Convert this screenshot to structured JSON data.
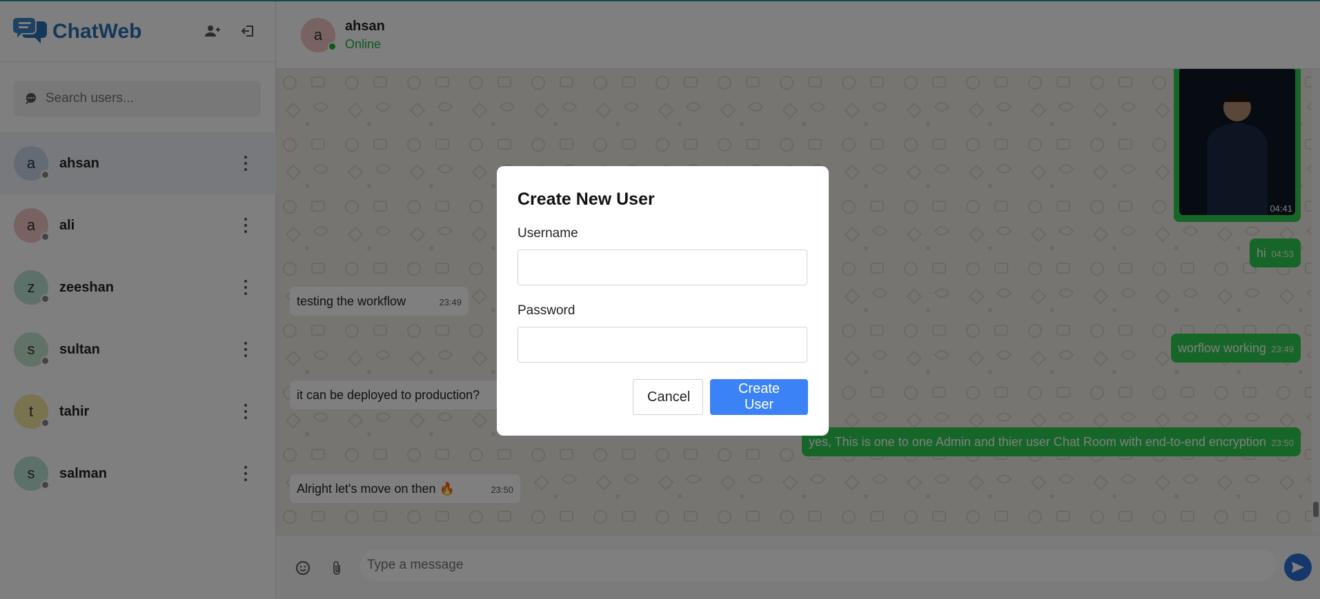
{
  "app": {
    "brand": "ChatWeb"
  },
  "sidebar": {
    "add_user_icon": "user-plus-icon",
    "logout_icon": "logout-icon",
    "search_placeholder": "Search users...",
    "users": [
      {
        "initial": "a",
        "name": "ahsan",
        "color": "#c7d6ea"
      },
      {
        "initial": "a",
        "name": "ali",
        "color": "#f1c4c4"
      },
      {
        "initial": "z",
        "name": "zeeshan",
        "color": "#b8e2d4"
      },
      {
        "initial": "s",
        "name": "sultan",
        "color": "#c4e5cc"
      },
      {
        "initial": "t",
        "name": "tahir",
        "color": "#f2e7a0"
      },
      {
        "initial": "s",
        "name": "salman",
        "color": "#b8e2d4"
      }
    ]
  },
  "chat": {
    "contact_initial": "a",
    "contact_name": "ahsan",
    "contact_status": "Online",
    "photo_time": "04:41",
    "messages": [
      {
        "dir": "out",
        "text": "hi",
        "time": "04:53"
      },
      {
        "dir": "in",
        "text": "testing the workflow",
        "time": "23:49"
      },
      {
        "dir": "out",
        "text": "worflow working",
        "time": "23:49"
      },
      {
        "dir": "in",
        "text": "it can be deployed to production?",
        "time": ""
      },
      {
        "dir": "out",
        "text": "yes, This is one to one Admin and thier user Chat Room with end-to-end encryption",
        "time": "23:50"
      },
      {
        "dir": "in",
        "text": "Alright let's move on then 🔥",
        "time": "23:50"
      }
    ],
    "composer_placeholder": "Type a message"
  },
  "modal": {
    "title": "Create New User",
    "username_label": "Username",
    "username_value": "",
    "password_label": "Password",
    "password_value": "",
    "cancel_label": "Cancel",
    "create_label": "Create User"
  }
}
